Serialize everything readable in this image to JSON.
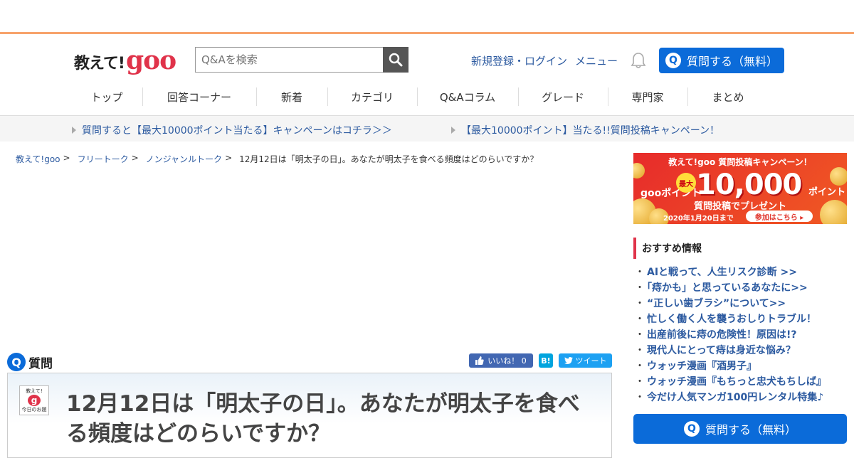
{
  "header": {
    "logo_text": "教えて!",
    "logo_goo": "goo",
    "search_placeholder": "Q&Aを検索",
    "register_login": "新規登録・ログイン",
    "menu": "メニュー",
    "ask_button": "質問する（無料）",
    "ask_q": "Q"
  },
  "nav": [
    {
      "label": "トップ"
    },
    {
      "label": "回答コーナー"
    },
    {
      "label": "新着"
    },
    {
      "label": "カテゴリ"
    },
    {
      "label": "Q&Aコラム"
    },
    {
      "label": "グレード"
    },
    {
      "label": "専門家"
    },
    {
      "label": "まとめ"
    }
  ],
  "campaign": {
    "link1": "質問すると【最大10000ポイント当たる】キャンペーンはコチラ＞＞",
    "link2": "【最大10000ポイント】当たる!!質問投稿キャンペーン！"
  },
  "breadcrumb": {
    "items": [
      "教えて!goo",
      "フリートーク",
      "ノンジャンルトーク"
    ],
    "separator": ">",
    "current": "12月12日は「明太子の日」。あなたが明太子を食べる頻度はどのらいですか？"
  },
  "question": {
    "section_label": "質問",
    "q_icon": "Q",
    "title": "12月12日は「明太子の日」。あなたが明太子を食べる頻度はどのらいですか？",
    "avatar_top": "教えて!",
    "avatar_g": "g",
    "avatar_bottom": "今日のお題"
  },
  "share": {
    "like_label": "いいね！ 0",
    "hatena_label": "B!",
    "tweet_label": "ツイート"
  },
  "banner": {
    "top": "教えて!goo 質問投稿キャンペーン！",
    "left": "gooポイント",
    "max": "最大",
    "amount": "10,000",
    "unit": "ポイント",
    "sub": "質問投稿でプレゼント",
    "date": "2020年1月20日まで",
    "button": "参加はこちら ▸"
  },
  "recommend": {
    "title": "おすすめ情報",
    "bullet": "・",
    "items": [
      "AIと戦って、人生リスク診断 >>",
      "「痔かも」と思っているあなたに>>",
      "“正しい歯ブラシ”について>>",
      "忙しく働く人を襲うおしりトラブル！",
      "出産前後に痔の危険性！原因は!?",
      "現代人にとって痔は身近な悩み？",
      "ウォッチ漫画『酒男子』",
      "ウォッチ漫画『もちっと忠犬もちしば』",
      "今だけ人気マンガ100円レンタル特集♪"
    ]
  },
  "sidebar": {
    "ask_button": "質問する（無料）"
  },
  "colors": {
    "accent_blue": "#0b6bd9",
    "link_blue": "#2c5aa0",
    "goo_red": "#e0334a",
    "top_border_orange": "#f7a36b",
    "facebook_blue": "#4267b2",
    "hatena_blue": "#00a4de",
    "twitter_blue": "#1da1f2"
  }
}
